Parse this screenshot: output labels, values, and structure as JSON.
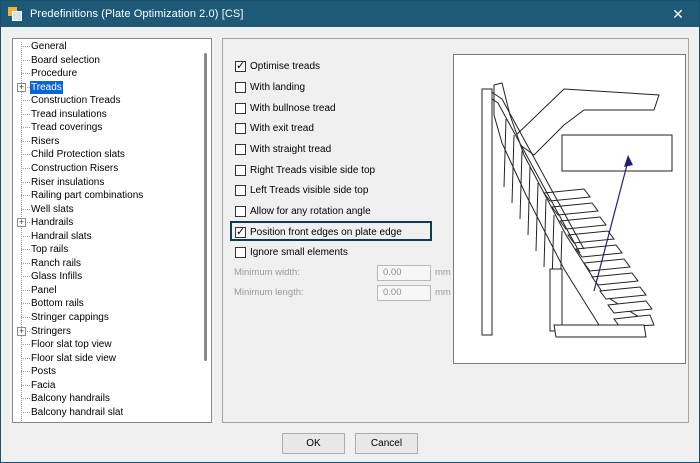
{
  "window": {
    "title": "Predefinitions (Plate Optimization 2.0) [CS]",
    "close_glyph": "✕"
  },
  "tree": {
    "items": [
      {
        "label": "General",
        "expandable": false,
        "selected": false
      },
      {
        "label": "Board selection",
        "expandable": false,
        "selected": false
      },
      {
        "label": "Procedure",
        "expandable": false,
        "selected": false
      },
      {
        "label": "Treads",
        "expandable": true,
        "selected": true
      },
      {
        "label": "Construction Treads",
        "expandable": false,
        "selected": false
      },
      {
        "label": "Tread insulations",
        "expandable": false,
        "selected": false
      },
      {
        "label": "Tread coverings",
        "expandable": false,
        "selected": false
      },
      {
        "label": "Risers",
        "expandable": false,
        "selected": false
      },
      {
        "label": "Child Protection slats",
        "expandable": false,
        "selected": false
      },
      {
        "label": "Construction Risers",
        "expandable": false,
        "selected": false
      },
      {
        "label": "Riser insulations",
        "expandable": false,
        "selected": false
      },
      {
        "label": "Railing part combinations",
        "expandable": false,
        "selected": false
      },
      {
        "label": "Well slats",
        "expandable": false,
        "selected": false
      },
      {
        "label": "Handrails",
        "expandable": true,
        "selected": false
      },
      {
        "label": "Handrail slats",
        "expandable": false,
        "selected": false
      },
      {
        "label": "Top rails",
        "expandable": false,
        "selected": false
      },
      {
        "label": "Ranch rails",
        "expandable": false,
        "selected": false
      },
      {
        "label": "Glass Infills",
        "expandable": false,
        "selected": false
      },
      {
        "label": "Panel",
        "expandable": false,
        "selected": false
      },
      {
        "label": "Bottom rails",
        "expandable": false,
        "selected": false
      },
      {
        "label": "Stringer cappings",
        "expandable": false,
        "selected": false
      },
      {
        "label": "Stringers",
        "expandable": true,
        "selected": false
      },
      {
        "label": "Floor slat top view",
        "expandable": false,
        "selected": false
      },
      {
        "label": "Floor slat side view",
        "expandable": false,
        "selected": false
      },
      {
        "label": "Posts",
        "expandable": false,
        "selected": false
      },
      {
        "label": "Facia",
        "expandable": false,
        "selected": false
      },
      {
        "label": "Balcony handrails",
        "expandable": false,
        "selected": false
      },
      {
        "label": "Balcony handrail slat",
        "expandable": false,
        "selected": false
      }
    ]
  },
  "options": [
    {
      "label": "Optimise treads",
      "checked": true
    },
    {
      "label": "With landing",
      "checked": false
    },
    {
      "label": "With bullnose tread",
      "checked": false
    },
    {
      "label": "With exit tread",
      "checked": false
    },
    {
      "label": "With straight tread",
      "checked": false
    },
    {
      "label": "Right Treads visible side top",
      "checked": false
    },
    {
      "label": "Left Treads visible side top",
      "checked": false
    },
    {
      "label": "Allow for any rotation angle",
      "checked": false
    },
    {
      "label": "Position front edges on plate edge",
      "checked": true
    },
    {
      "label": "Ignore small elements",
      "checked": false
    }
  ],
  "fields": {
    "min_width": {
      "label": "Minimum width:",
      "value": "0.00",
      "unit": "mm"
    },
    "min_length": {
      "label": "Minimum length:",
      "value": "0.00",
      "unit": "mm"
    }
  },
  "buttons": {
    "ok": "OK",
    "cancel": "Cancel"
  },
  "check_glyph": "✓",
  "expander_glyph": "+"
}
